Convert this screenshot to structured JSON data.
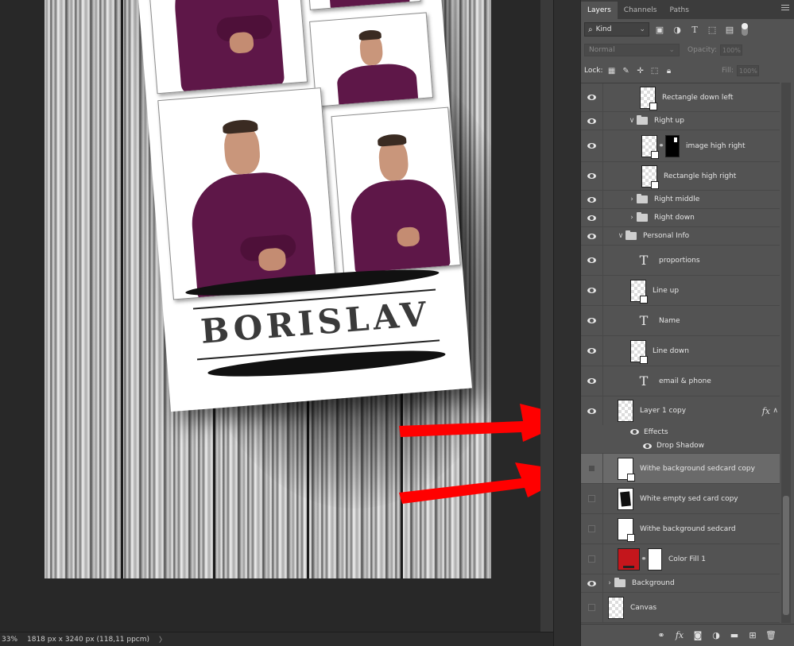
{
  "document": {
    "card_name": "BORISLAV"
  },
  "status_bar": {
    "zoom": "33%",
    "info": "1818 px x 3240 px (118,11 ppcm)",
    "arrow": "〉"
  },
  "panel": {
    "tabs": [
      {
        "label": "Layers",
        "active": true
      },
      {
        "label": "Channels",
        "active": false
      },
      {
        "label": "Paths",
        "active": false
      }
    ],
    "filter": {
      "kind_label": "Kind"
    },
    "blend_mode": "Normal",
    "opacity_label": "Opacity:",
    "opacity_value": "100%",
    "lock_label": "Lock:",
    "fill_label": "Fill:",
    "fill_value": "100%",
    "layers": [
      {
        "name": "Rectangle down left",
        "type": "shape",
        "visible": true,
        "indent": 2
      },
      {
        "name": "Right up",
        "type": "group",
        "visible": true,
        "indent": 1,
        "expanded": true
      },
      {
        "name": "image high right",
        "type": "image-mask",
        "visible": true,
        "indent": 2
      },
      {
        "name": "Rectangle high right",
        "type": "shape",
        "visible": true,
        "indent": 2
      },
      {
        "name": "Right middle",
        "type": "group",
        "visible": true,
        "indent": 1,
        "expanded": false
      },
      {
        "name": "Right down",
        "type": "group",
        "visible": true,
        "indent": 1,
        "expanded": false
      },
      {
        "name": "Personal Info",
        "type": "group",
        "visible": true,
        "indent": 0,
        "expanded": true
      },
      {
        "name": "proportions",
        "type": "text",
        "visible": true,
        "indent": 1
      },
      {
        "name": "Line up",
        "type": "shape",
        "visible": true,
        "indent": 1
      },
      {
        "name": "Name",
        "type": "text",
        "visible": true,
        "indent": 1
      },
      {
        "name": "Line down",
        "type": "shape",
        "visible": true,
        "indent": 1
      },
      {
        "name": "email & phone",
        "type": "text",
        "visible": true,
        "indent": 1
      },
      {
        "name": "Layer 1 copy",
        "type": "pixel",
        "visible": true,
        "indent": 0,
        "fx": true
      },
      {
        "name": "Withe background sedcard copy",
        "type": "shape-white",
        "visible": false,
        "indent": 0,
        "selected": true
      },
      {
        "name": "White empty sed card copy",
        "type": "pixel-dark",
        "visible": false,
        "indent": 0
      },
      {
        "name": "Withe background sedcard",
        "type": "shape-white",
        "visible": false,
        "indent": 0
      },
      {
        "name": "Color Fill 1",
        "type": "fill",
        "visible": false,
        "indent": 0
      },
      {
        "name": "Background",
        "type": "group",
        "visible": true,
        "indent": 0,
        "expanded": false
      },
      {
        "name": "Canvas",
        "type": "pixel",
        "visible": false,
        "indent": 0
      }
    ],
    "effects": {
      "label": "Effects",
      "drop_shadow": "Drop Shadow"
    },
    "fx_label": "fx"
  },
  "colors": {
    "accent_arrow": "#ff0000",
    "shirt": "#5e1748",
    "color_fill": "#c4161c",
    "panel_bg": "#535353"
  }
}
